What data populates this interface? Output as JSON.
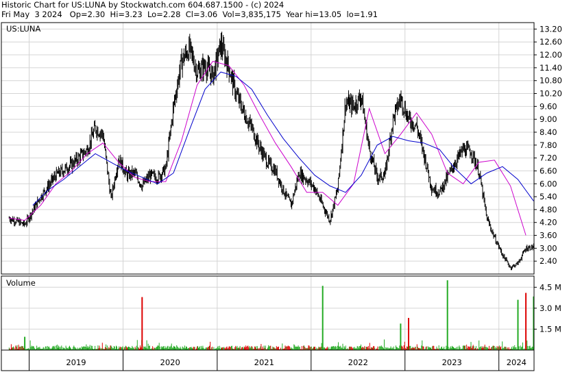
{
  "header": {
    "line1": "Historic Chart for US:LUNA by Stockwatch.com 604.687.1500 - (c) 2024",
    "line2": "Fri May  3 2024   Op=2.30  Hi=3.23  Lo=2.28  Cl=3.06  Vol=3,835,175  Year hi=13.05  lo=1.91"
  },
  "colors": {
    "price": "#000000",
    "ma_short": "#cc00cc",
    "ma_long": "#0000cc",
    "vol_up": "#22aa22",
    "vol_down": "#dd0000",
    "grid": "#d4d4d4"
  },
  "chart_data": [
    {
      "type": "line",
      "title": "US:LUNA",
      "ylim": [
        1.8,
        13.5
      ],
      "y_ticks": [
        "13.20",
        "12.60",
        "12.00",
        "11.40",
        "10.80",
        "10.20",
        "9.60",
        "9.00",
        "8.40",
        "7.80",
        "7.20",
        "6.60",
        "6.00",
        "5.40",
        "4.80",
        "4.20",
        "3.60",
        "3.00",
        "2.40"
      ],
      "x_labels": [
        "2019",
        "2020",
        "2021",
        "2022",
        "2023",
        "2024"
      ],
      "grid": true,
      "series": [
        {
          "kind": "price",
          "x": [
            "2018-10",
            "2018-12",
            "2019-02",
            "2019-04",
            "2019-06",
            "2019-08",
            "2019-09",
            "2019-10",
            "2019-11",
            "2019-12",
            "2020-01",
            "2020-02",
            "2020-03",
            "2020-04",
            "2020-05",
            "2020-06",
            "2020-07",
            "2020-08",
            "2020-09",
            "2020-10",
            "2020-11",
            "2020-12",
            "2021-01",
            "2021-02",
            "2021-03",
            "2021-04",
            "2021-05",
            "2021-06",
            "2021-07",
            "2021-08",
            "2021-09",
            "2021-10",
            "2021-11",
            "2021-12",
            "2022-01",
            "2022-02",
            "2022-03",
            "2022-04",
            "2022-05",
            "2022-06",
            "2022-07",
            "2022-08",
            "2022-09",
            "2022-10",
            "2022-11",
            "2022-12",
            "2023-01",
            "2023-02",
            "2023-03",
            "2023-04",
            "2023-05",
            "2023-06",
            "2023-07",
            "2023-08",
            "2023-09",
            "2023-10",
            "2023-11",
            "2023-12",
            "2024-01",
            "2024-02",
            "2024-03",
            "2024-04",
            "2024-05"
          ],
          "values": [
            4.4,
            4.1,
            5.4,
            6.4,
            6.9,
            7.6,
            8.6,
            8.3,
            5.3,
            7.2,
            6.4,
            6.5,
            5.9,
            6.4,
            6.3,
            6.7,
            9.6,
            11.7,
            12.3,
            11.2,
            11.5,
            11.0,
            12.5,
            11.4,
            10.2,
            9.3,
            8.6,
            7.7,
            7.0,
            6.6,
            5.7,
            5.0,
            6.5,
            6.2,
            5.8,
            5.0,
            4.3,
            5.8,
            9.8,
            9.6,
            10.1,
            7.6,
            6.3,
            6.4,
            9.0,
            10.0,
            9.0,
            8.7,
            7.4,
            5.8,
            5.6,
            6.3,
            7.0,
            7.6,
            7.5,
            6.6,
            4.4,
            3.5,
            2.7,
            2.1,
            2.3,
            3.0,
            3.06
          ]
        },
        {
          "kind": "ma_short",
          "x": [
            "2018-10",
            "2018-12",
            "2019-02",
            "2019-04",
            "2019-06",
            "2019-08",
            "2019-10",
            "2019-12",
            "2020-02",
            "2020-04",
            "2020-06",
            "2020-08",
            "2020-10",
            "2020-12",
            "2021-02",
            "2021-04",
            "2021-06",
            "2021-08",
            "2021-10",
            "2021-12",
            "2022-02",
            "2022-04",
            "2022-06",
            "2022-08",
            "2022-10",
            "2022-12",
            "2023-02",
            "2023-04",
            "2023-06",
            "2023-08",
            "2023-10",
            "2023-12",
            "2024-02",
            "2024-04"
          ],
          "values": [
            4.4,
            4.3,
            5.0,
            6.0,
            6.6,
            7.4,
            7.9,
            7.0,
            6.3,
            6.1,
            6.1,
            8.0,
            10.6,
            11.7,
            11.5,
            10.6,
            9.2,
            7.9,
            6.8,
            5.6,
            5.6,
            5.0,
            6.0,
            9.5,
            7.4,
            8.3,
            9.3,
            8.3,
            6.5,
            6.0,
            7.0,
            7.1,
            5.9,
            3.6
          ]
        },
        {
          "kind": "ma_long",
          "x": [
            "2019-01",
            "2019-03",
            "2019-05",
            "2019-07",
            "2019-09",
            "2019-11",
            "2020-01",
            "2020-03",
            "2020-05",
            "2020-07",
            "2020-09",
            "2020-11",
            "2021-01",
            "2021-03",
            "2021-05",
            "2021-07",
            "2021-09",
            "2021-11",
            "2022-01",
            "2022-03",
            "2022-05",
            "2022-07",
            "2022-09",
            "2022-11",
            "2023-01",
            "2023-03",
            "2023-05",
            "2023-07",
            "2023-09",
            "2023-11",
            "2024-01",
            "2024-03",
            "2024-05"
          ],
          "values": [
            5.0,
            5.7,
            6.2,
            6.8,
            7.4,
            7.0,
            6.6,
            6.3,
            6.0,
            6.5,
            8.5,
            10.4,
            11.2,
            11.0,
            10.4,
            9.2,
            8.1,
            7.2,
            6.4,
            5.9,
            5.6,
            6.4,
            7.8,
            8.2,
            8.0,
            7.9,
            7.6,
            6.7,
            6.0,
            6.5,
            6.8,
            6.2,
            5.2
          ]
        }
      ]
    },
    {
      "type": "bar",
      "title": "Volume",
      "ylim": [
        0,
        5.3
      ],
      "y_ticks": [
        "4.5 M",
        "3.0 M",
        "1.5 M"
      ],
      "spikes": [
        {
          "x": "2018-12",
          "value": 0.95
        },
        {
          "x": "2020-03",
          "value": 3.8
        },
        {
          "x": "2022-02",
          "value": 4.6
        },
        {
          "x": "2022-12",
          "value": 1.9
        },
        {
          "x": "2023-01",
          "value": 2.3
        },
        {
          "x": "2023-06",
          "value": 5.0
        },
        {
          "x": "2024-03",
          "value": 3.6
        },
        {
          "x": "2024-04",
          "value": 4.1
        },
        {
          "x": "2024-05",
          "value": 3.84
        }
      ]
    }
  ]
}
